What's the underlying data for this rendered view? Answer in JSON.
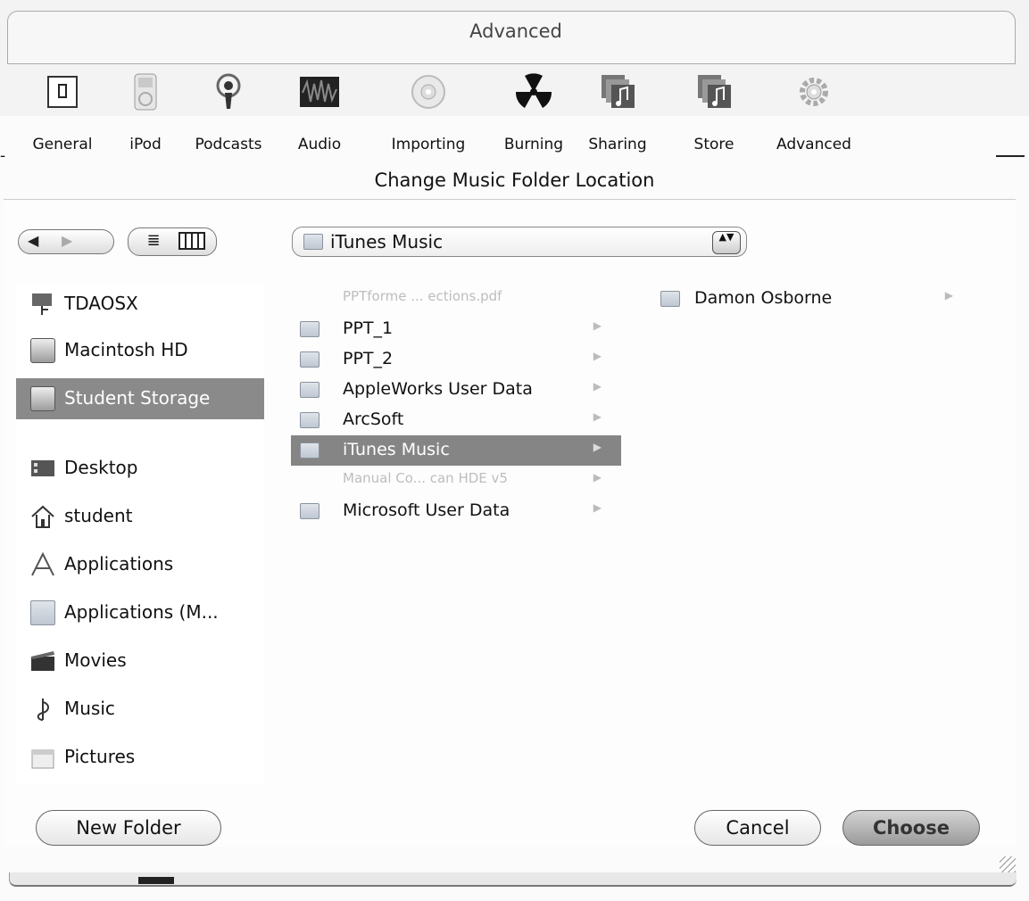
{
  "window": {
    "title": "Advanced"
  },
  "toolbar": {
    "items": [
      {
        "label": "General",
        "icon": "general-switch-icon"
      },
      {
        "label": "iPod",
        "icon": "ipod-icon"
      },
      {
        "label": "Podcasts",
        "icon": "podcast-icon"
      },
      {
        "label": "Audio",
        "icon": "audio-waveform-icon"
      },
      {
        "label": "Importing",
        "icon": "cd-import-icon"
      },
      {
        "label": "Burning",
        "icon": "radiation-burn-icon"
      },
      {
        "label": "Sharing",
        "icon": "sharing-music-icon"
      },
      {
        "label": "Store",
        "icon": "store-music-icon"
      },
      {
        "label": "Advanced",
        "icon": "gear-icon"
      }
    ]
  },
  "sheet": {
    "title": "Change Music Folder Location"
  },
  "navigation": {
    "back_glyph": "◀",
    "forward_glyph": "▶",
    "list_glyph": "≣"
  },
  "path_popup": {
    "label": "iTunes Music",
    "stepper_glyph": "▲▼"
  },
  "sidebar": {
    "items": [
      {
        "label": "TDAOSX",
        "icon": "network-volume-icon",
        "selected": false
      },
      {
        "label": "Macintosh HD",
        "icon": "hard-drive-icon",
        "selected": false
      },
      {
        "label": "Student Storage",
        "icon": "hard-drive-icon",
        "selected": true
      },
      {
        "label": "Desktop",
        "icon": "desktop-icon",
        "selected": false
      },
      {
        "label": "student",
        "icon": "home-icon",
        "selected": false
      },
      {
        "label": "Applications",
        "icon": "applications-icon",
        "selected": false
      },
      {
        "label": "Applications (M...",
        "icon": "folder-icon",
        "selected": false
      },
      {
        "label": "Movies",
        "icon": "movies-icon",
        "selected": false
      },
      {
        "label": "Music",
        "icon": "music-icon",
        "selected": false
      },
      {
        "label": "Pictures",
        "icon": "pictures-icon",
        "selected": false
      }
    ]
  },
  "column1": {
    "items": [
      {
        "label": "PPTforme ... ections.pdf",
        "dim": true,
        "arrow": false
      },
      {
        "label": "PPT_1",
        "dim": false,
        "arrow": true
      },
      {
        "label": "PPT_2",
        "dim": false,
        "arrow": true
      },
      {
        "label": "AppleWorks User Data",
        "dim": false,
        "arrow": true
      },
      {
        "label": "ArcSoft",
        "dim": false,
        "arrow": true
      },
      {
        "label": "iTunes Music",
        "dim": false,
        "arrow": true,
        "selected": true
      },
      {
        "label": "Manual Co... can HDE v5",
        "dim": true,
        "arrow": true
      },
      {
        "label": "Microsoft User Data",
        "dim": false,
        "arrow": true
      }
    ]
  },
  "column2": {
    "items": [
      {
        "label": "Damon Osborne",
        "arrow": true
      }
    ]
  },
  "buttons": {
    "new_folder": "New Folder",
    "cancel": "Cancel",
    "choose": "Choose"
  },
  "colors": {
    "selection": "#858585",
    "default_button": "#a8a8a8"
  }
}
